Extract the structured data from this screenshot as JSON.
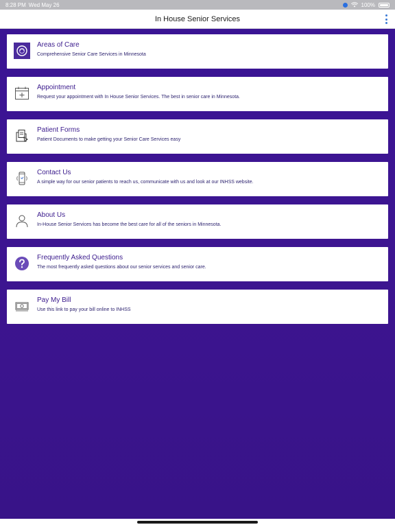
{
  "status_bar": {
    "time": "8:28 PM",
    "date": "Wed May 26",
    "battery": "100%"
  },
  "nav": {
    "title": "In House Senior Services"
  },
  "colors": {
    "accent": "#3a1a8c",
    "background": "#3a1590",
    "kebab": "#3b7bd6"
  },
  "menu": [
    {
      "title": "Areas of Care",
      "subtitle": "Comprehensive Senior Care Services in Minnesota",
      "icon": "areas-of-care-logo-icon"
    },
    {
      "title": "Appointment",
      "subtitle": "Request your appointment with In House Senior Services. The best in senior care in Minnesota.",
      "icon": "calendar-icon"
    },
    {
      "title": "Patient Forms",
      "subtitle": "Patient Documents to make getting your Senior Care Services easy",
      "icon": "document-folder-icon"
    },
    {
      "title": "Contact Us",
      "subtitle": "A simple way for our senior patients to reach us, communicate with us and look at our INHSS website.",
      "icon": "phone-icon"
    },
    {
      "title": "About Us",
      "subtitle": "In-House Senior Services has become the best care for all of the seniors in Minnesota.",
      "icon": "person-icon"
    },
    {
      "title": "Frequently Asked Questions",
      "subtitle": "The most frequently asked questions about our senior services and senior care.",
      "icon": "question-icon"
    },
    {
      "title": "Pay My Bill",
      "subtitle": "Use this link to pay your bill online to INHSS",
      "icon": "bill-icon"
    }
  ]
}
